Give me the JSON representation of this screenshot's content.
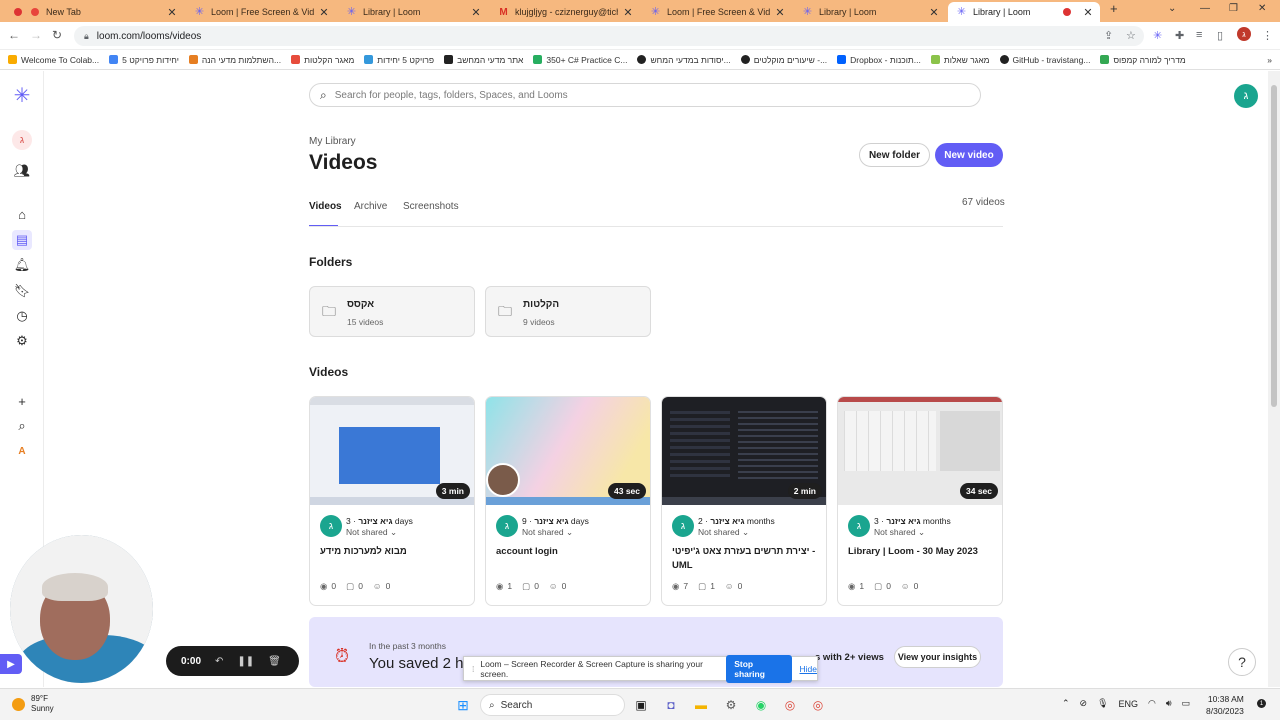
{
  "browser": {
    "tabs": [
      {
        "title": "New Tab",
        "favicon": "chrome-icon"
      },
      {
        "title": "Loom | Free Screen & Video Re",
        "favicon": "loom-icon"
      },
      {
        "title": "Library | Loom",
        "favicon": "loom-icon"
      },
      {
        "title": "klujgljyg - cziznerguy@tichone",
        "favicon": "gmail-icon"
      },
      {
        "title": "Loom | Free Screen & Video Re",
        "favicon": "loom-icon"
      },
      {
        "title": "Library | Loom",
        "favicon": "loom-icon"
      },
      {
        "title": "Library | Loom",
        "favicon": "loom-icon",
        "active": true
      }
    ],
    "url": "loom.com/looms/videos",
    "bookmarks": [
      "Welcome To Colab...",
      "5 יחידות פרויקט",
      "השתלמות מדעי הנה...",
      "מאגר הקלטות",
      "פרויקט 5 יחידות",
      "אתר מדעי המחשב",
      "350+ C# Practice C...",
      "יסודות במדעי המחש...",
      "שיעורים מוקלטים -...",
      "Dropbox - תוכנות...",
      "מאגר שאלות",
      "GitHub - travistang...",
      "מדריך למורה קמפוס"
    ],
    "brand_color": "#625df5"
  },
  "app": {
    "search_placeholder": "Search for people, tags, folders, Spaces, and Looms",
    "avatar_letter": "ג",
    "breadcrumb": "My Library",
    "title": "Videos",
    "new_folder": "New folder",
    "new_video": "New video",
    "tabs": [
      "Videos",
      "Archive",
      "Screenshots"
    ],
    "video_count": "67 videos",
    "folders_heading": "Folders",
    "folders": [
      {
        "name": "אקסס",
        "count": "15 videos"
      },
      {
        "name": "הקלטות",
        "count": "9 videos"
      }
    ],
    "videos_heading": "Videos",
    "videos": [
      {
        "duration": "3 min",
        "author": "גיא ציזנר",
        "age": "· 3 days",
        "share": "Not shared",
        "title": "מבוא למערכות מידע",
        "views": "0",
        "comments": "0",
        "reactions": "0"
      },
      {
        "duration": "43 sec",
        "author": "גיא ציזנר",
        "age": "· 9 days",
        "share": "Not shared",
        "title": "account login",
        "views": "1",
        "comments": "0",
        "reactions": "0"
      },
      {
        "duration": "2 min",
        "author": "גיא ציזנר",
        "age": "· 2 months",
        "share": "Not shared",
        "title": "יצירת תרשים בעזרת צאט ג'יפיטי - UML",
        "views": "7",
        "comments": "1",
        "reactions": "0"
      },
      {
        "duration": "34 sec",
        "author": "גיא ציזנר",
        "age": "· 3 months",
        "share": "Not shared",
        "title": "Library | Loom - 30 May 2023",
        "views": "1",
        "comments": "0",
        "reactions": "0"
      }
    ],
    "insights": {
      "period": "In the past 3 months",
      "saved": "You saved 2 h",
      "right_text": "s with 2+ views",
      "button": "View your insights"
    }
  },
  "sharing_bar": {
    "text": "Loom – Screen Recorder & Screen Capture is sharing your screen.",
    "stop": "Stop sharing",
    "hide": "Hide"
  },
  "recorder": {
    "time": "0:00"
  },
  "taskbar": {
    "temp": "89°F",
    "condition": "Sunny",
    "search": "Search",
    "lang": "ENG",
    "time": "10:38 AM",
    "date": "8/30/2023"
  }
}
